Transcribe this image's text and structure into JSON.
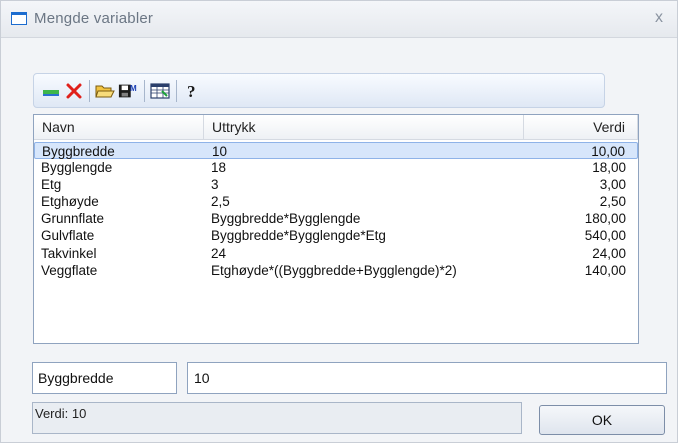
{
  "window": {
    "title": "Mengde variabler",
    "close_glyph": "x"
  },
  "toolbar": {
    "buttons": [
      {
        "name": "new-variable",
        "icon": "new-row-icon"
      },
      {
        "name": "delete-variable",
        "icon": "delete-x-icon"
      },
      {
        "name": "open",
        "icon": "open-folder-icon"
      },
      {
        "name": "save-macro",
        "icon": "save-macro-icon"
      },
      {
        "name": "table-view",
        "icon": "table-icon"
      },
      {
        "name": "help",
        "icon": "help-question-icon"
      }
    ]
  },
  "list": {
    "columns": [
      "Navn",
      "Uttrykk",
      "Verdi"
    ],
    "rows": [
      {
        "name": "Byggbredde",
        "expr": "10",
        "value": "10,00",
        "selected": true
      },
      {
        "name": "Bygglengde",
        "expr": "18",
        "value": "18,00"
      },
      {
        "name": "Etg",
        "expr": "3",
        "value": "3,00"
      },
      {
        "name": "Etghøyde",
        "expr": "2,5",
        "value": "2,50"
      },
      {
        "name": "Grunnflate",
        "expr": "Byggbredde*Bygglengde",
        "value": "180,00"
      },
      {
        "name": "Gulvflate",
        "expr": "Byggbredde*Bygglengde*Etg",
        "value": "540,00"
      },
      {
        "name": "Takvinkel",
        "expr": "24",
        "value": "24,00"
      },
      {
        "name": "Veggflate",
        "expr": "Etghøyde*((Byggbredde+Bygglengde)*2)",
        "value": "140,00"
      }
    ]
  },
  "editor": {
    "name_value": "Byggbredde",
    "expr_value": "10"
  },
  "status": {
    "text": "Verdi: 10"
  },
  "buttons": {
    "ok_label": "OK"
  },
  "colors": {
    "accent": "#1c6ccf",
    "selection": "#d7e6fb"
  }
}
